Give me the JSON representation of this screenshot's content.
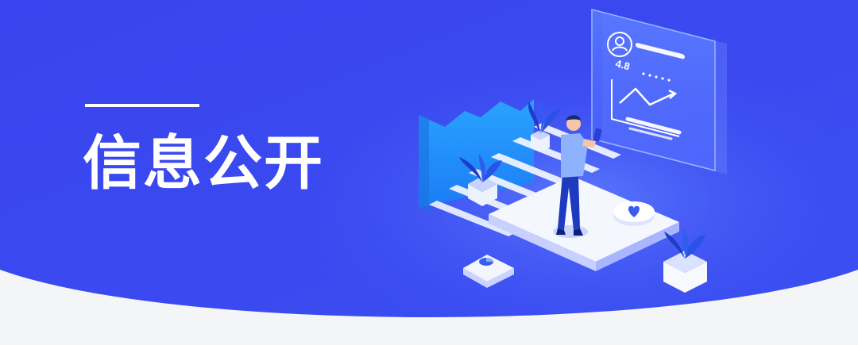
{
  "banner": {
    "title": "信息公开",
    "card_rating": "4.8",
    "colors": {
      "background_top": "#3b4df0",
      "background_glow": "#5a74ff",
      "footer_curve": "#f4f5f7",
      "title_text": "#ffffff"
    }
  }
}
